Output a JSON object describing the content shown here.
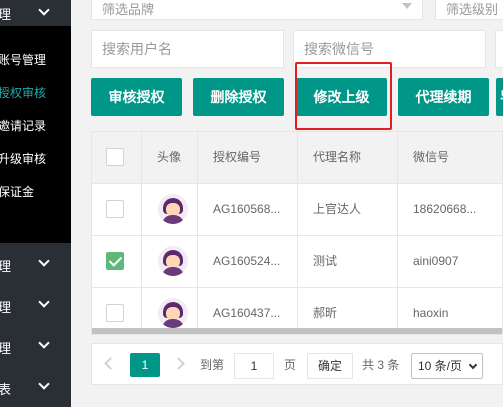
{
  "sidebar": {
    "top_label": "理",
    "sub_items": [
      {
        "label": "账号管理"
      },
      {
        "label": "授权审核"
      },
      {
        "label": "邀请记录"
      },
      {
        "label": "升级审核"
      },
      {
        "label": "保证金"
      }
    ],
    "groups": [
      {
        "label": "理"
      },
      {
        "label": "理"
      },
      {
        "label": "理"
      },
      {
        "label": "表"
      }
    ]
  },
  "filters": {
    "brand_placeholder": "筛选品牌",
    "level_placeholder": "筛选级别"
  },
  "search": {
    "username_placeholder": "搜索用户名",
    "wechat_placeholder": "搜索微信号"
  },
  "toolbar": {
    "review_label": "审核授权",
    "delete_label": "删除授权",
    "modify_label": "修改上级",
    "renew_label": "代理续期",
    "more_label": "导"
  },
  "table": {
    "headers": [
      "头像",
      "授权编号",
      "代理名称",
      "微信号"
    ],
    "rows": [
      {
        "checked": false,
        "auth_no": "AG160568...",
        "agent_name": "上官达人",
        "wechat": "18620668..."
      },
      {
        "checked": true,
        "auth_no": "AG160524...",
        "agent_name": "测试",
        "wechat": "aini0907"
      },
      {
        "checked": false,
        "auth_no": "AG160437...",
        "agent_name": "郝昕",
        "wechat": "haoxin"
      }
    ]
  },
  "pager": {
    "current_page": "1",
    "goto_label": "到第",
    "goto_value": "1",
    "page_unit": "页",
    "confirm_label": "确定",
    "total_label": "共 3 条",
    "page_size_label": "10 条/页"
  },
  "colors": {
    "primary": "#009688",
    "highlight": "#e41e1e",
    "active_sidebar": "#22aaaa",
    "checked": "#5fb878"
  }
}
